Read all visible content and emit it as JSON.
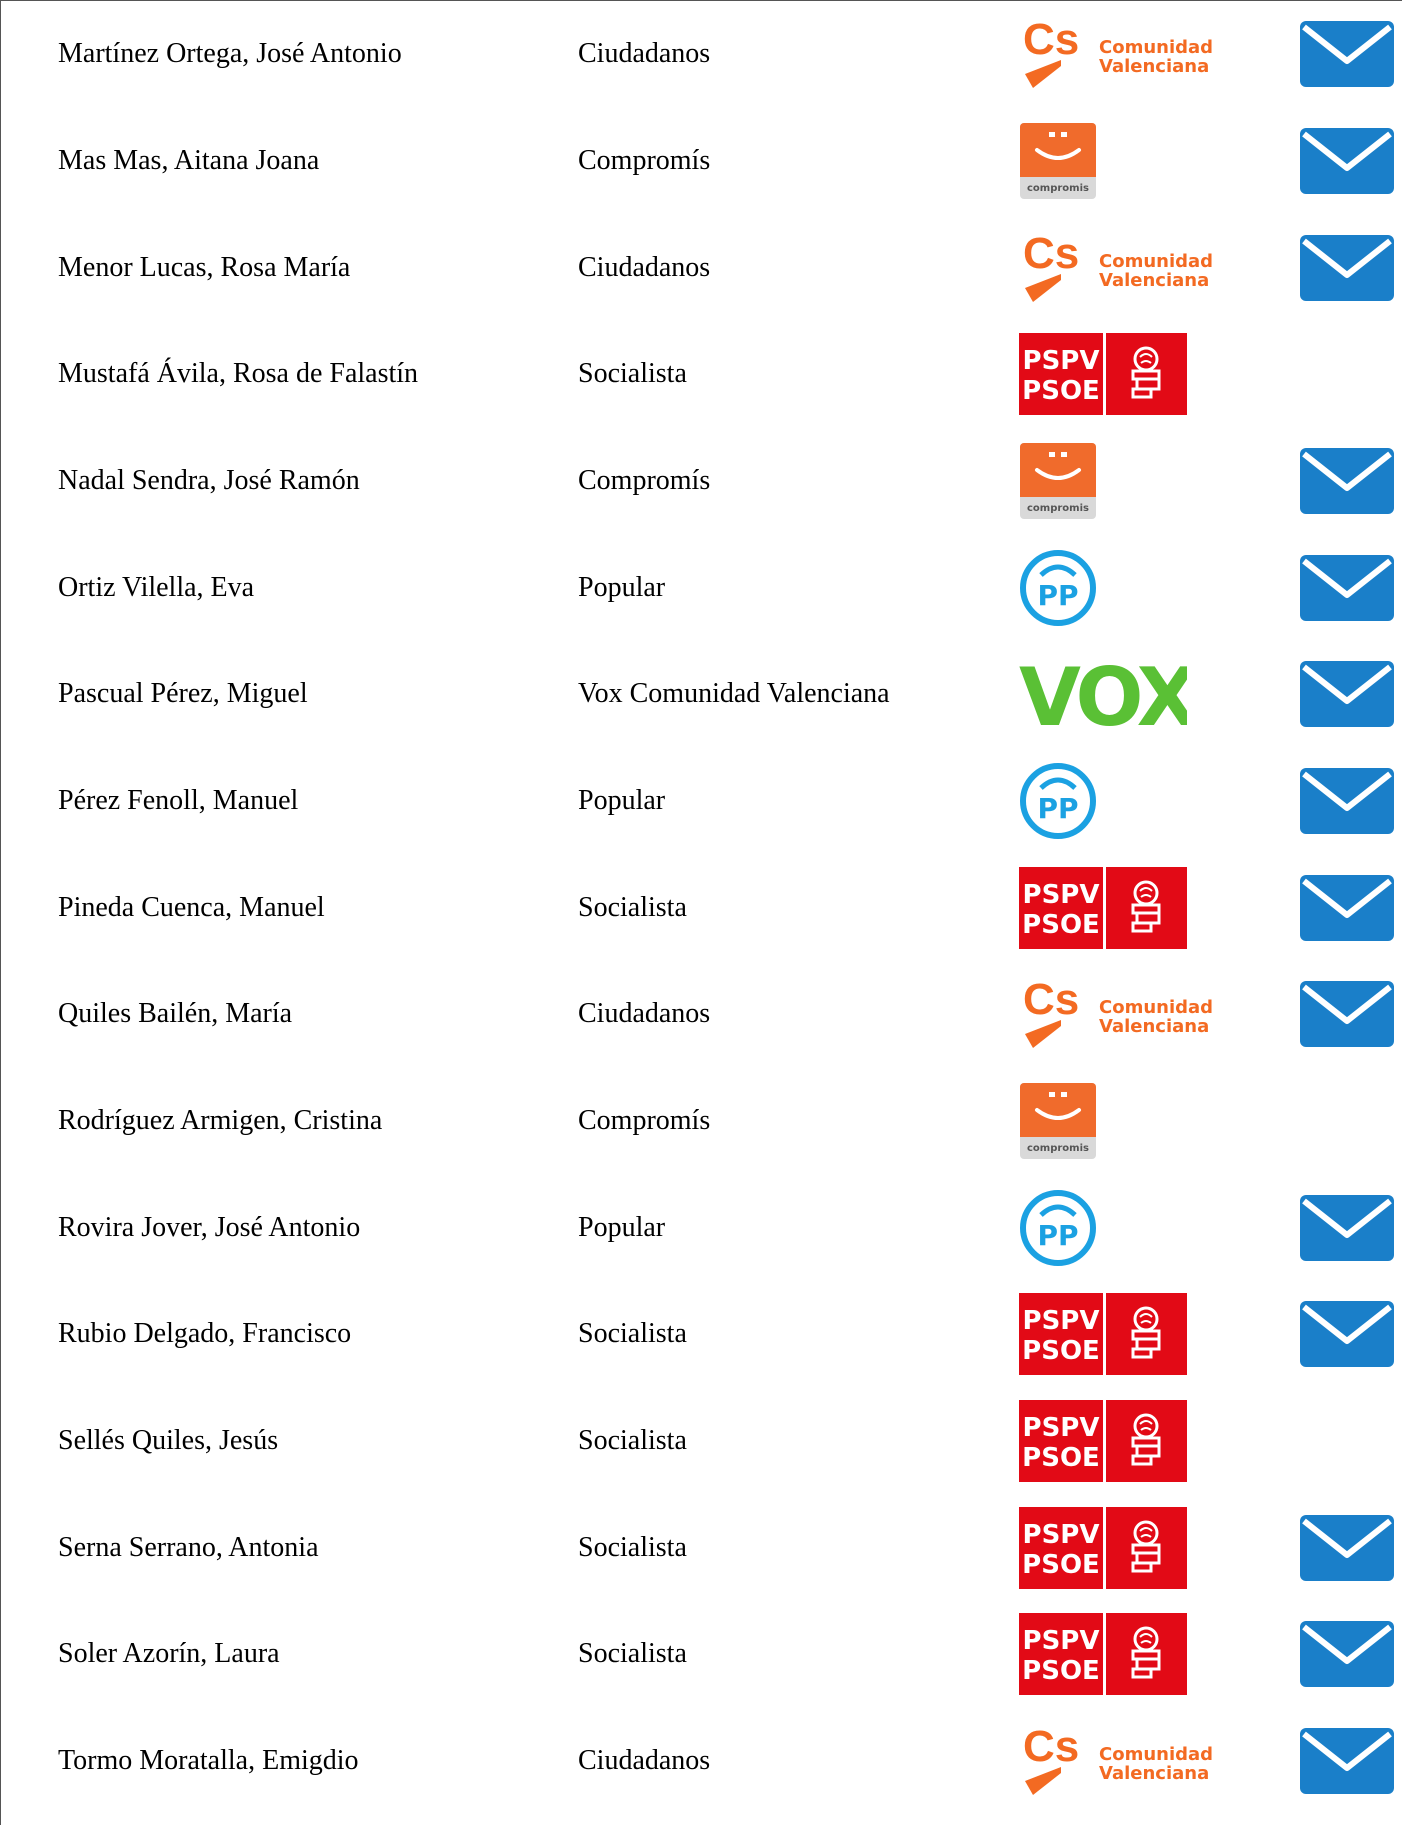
{
  "parties": {
    "ciudadanos": {
      "logo_text": "Cs",
      "logo_sub_line1": "Comunidad",
      "logo_sub_line2": "Valenciana",
      "color": "#f36a22",
      "icon": "ciudadanos-logo-icon"
    },
    "compromis": {
      "logo_text": "compromis",
      "color": "#f06b2c",
      "icon": "compromis-logo-icon"
    },
    "socialista": {
      "logo_line1": "PSPV",
      "logo_line2": "PSOE",
      "color": "#e20a16",
      "icon": "pspv-psoe-logo-icon"
    },
    "popular": {
      "logo_text": "PP",
      "color": "#1ba1e2",
      "icon": "pp-logo-icon"
    },
    "vox": {
      "logo_text": "VOX",
      "color": "#5ac035",
      "icon": "vox-logo-icon"
    }
  },
  "mail_icon": {
    "icon": "envelope-icon",
    "color": "#1a7fc9"
  },
  "rows": [
    {
      "name": "Martínez Ortega, José Antonio",
      "party": "Ciudadanos",
      "party_key": "ciudadanos",
      "has_mail": true
    },
    {
      "name": "Mas Mas, Aitana Joana",
      "party": "Compromís",
      "party_key": "compromis",
      "has_mail": true
    },
    {
      "name": "Menor Lucas, Rosa María",
      "party": "Ciudadanos",
      "party_key": "ciudadanos",
      "has_mail": true
    },
    {
      "name": "Mustafá Ávila, Rosa de Falastín",
      "party": "Socialista",
      "party_key": "socialista",
      "has_mail": false
    },
    {
      "name": "Nadal Sendra, José Ramón",
      "party": "Compromís",
      "party_key": "compromis",
      "has_mail": true
    },
    {
      "name": "Ortiz Vilella, Eva",
      "party": "Popular",
      "party_key": "popular",
      "has_mail": true
    },
    {
      "name": "Pascual Pérez, Miguel",
      "party": "Vox Comunidad Valenciana",
      "party_key": "vox",
      "has_mail": true
    },
    {
      "name": "Pérez Fenoll, Manuel",
      "party": "Popular",
      "party_key": "popular",
      "has_mail": true
    },
    {
      "name": "Pineda Cuenca, Manuel",
      "party": "Socialista",
      "party_key": "socialista",
      "has_mail": true
    },
    {
      "name": "Quiles Bailén, María",
      "party": "Ciudadanos",
      "party_key": "ciudadanos",
      "has_mail": true
    },
    {
      "name": "Rodríguez Armigen, Cristina",
      "party": "Compromís",
      "party_key": "compromis",
      "has_mail": false
    },
    {
      "name": "Rovira Jover, José Antonio",
      "party": "Popular",
      "party_key": "popular",
      "has_mail": true
    },
    {
      "name": "Rubio Delgado, Francisco",
      "party": "Socialista",
      "party_key": "socialista",
      "has_mail": true
    },
    {
      "name": "Sellés Quiles, Jesús",
      "party": "Socialista",
      "party_key": "socialista",
      "has_mail": false
    },
    {
      "name": "Serna Serrano, Antonia",
      "party": "Socialista",
      "party_key": "socialista",
      "has_mail": true
    },
    {
      "name": "Soler Azorín, Laura",
      "party": "Socialista",
      "party_key": "socialista",
      "has_mail": true
    },
    {
      "name": "Tormo Moratalla, Emigdio",
      "party": "Ciudadanos",
      "party_key": "ciudadanos",
      "has_mail": true
    }
  ]
}
